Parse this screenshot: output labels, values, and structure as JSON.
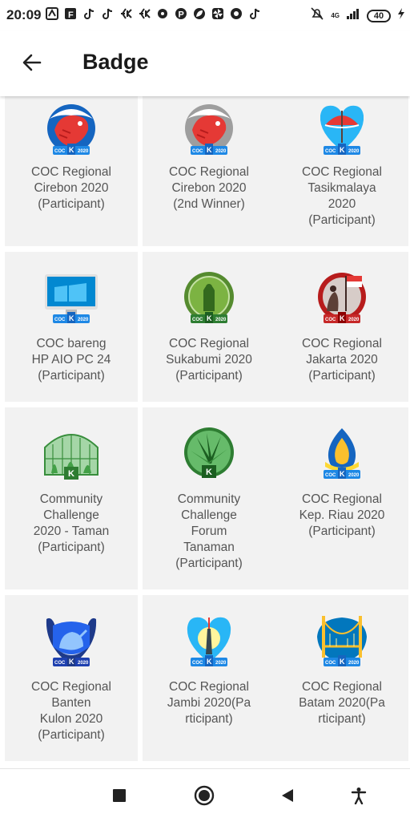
{
  "status_bar": {
    "time": "20:09",
    "notification_icons": [
      "app-icon",
      "f-icon",
      "tiktok-icon",
      "tiktok-icon",
      "k-icon",
      "k-icon",
      "chat-icon",
      "pinterest-icon",
      "leaf-icon",
      "pinwheel-icon",
      "circle-app-icon",
      "tiktok-icon"
    ],
    "network": "4G",
    "battery": "40"
  },
  "appbar": {
    "title": "Badge"
  },
  "badges": [
    {
      "label": "COC Regional\nCirebon 2020\n(Participant)",
      "icon": "shrimp-badge-icon"
    },
    {
      "label": "COC Regional\nCirebon 2020\n(2nd Winner)",
      "icon": "shrimp-silver-badge-icon"
    },
    {
      "label": "COC Regional\nTasikmalaya\n2020\n(Participant)",
      "icon": "umbrella-badge-icon"
    },
    {
      "label": "COC bareng\nHP AIO PC 24\n(Participant)",
      "icon": "computer-badge-icon"
    },
    {
      "label": "COC Regional\nSukabumi 2020\n(Participant)",
      "icon": "statue-badge-icon"
    },
    {
      "label": "COC Regional\nJakarta 2020\n(Participant)",
      "icon": "flag-badge-icon"
    },
    {
      "label": "Community\nChallenge\n2020 - Taman\n(Participant)",
      "icon": "greenhouse-badge-icon"
    },
    {
      "label": "Community\nChallenge\nForum\nTanaman\n(Participant)",
      "icon": "plant-badge-icon"
    },
    {
      "label": "COC Regional\nKep. Riau 2020\n(Participant)",
      "icon": "flame-badge-icon"
    },
    {
      "label": "COC Regional\nBanten\nKulon 2020\n(Participant)",
      "icon": "rhino-badge-icon"
    },
    {
      "label": "COC Regional\nJambi 2020(Pa\nrticipant)",
      "icon": "tower-badge-icon"
    },
    {
      "label": "COC Regional\nBatam 2020(Pa\nrticipant)",
      "icon": "bridge-badge-icon"
    }
  ],
  "badge_ribbon_text": "COC K 2020",
  "colors": {
    "card_bg": "#f2f2f2",
    "label": "#555555",
    "ribbon": "#1e88e5"
  },
  "navbar": {
    "icons": [
      "recents-square-icon",
      "home-circle-icon",
      "back-triangle-icon",
      "accessibility-icon"
    ]
  }
}
